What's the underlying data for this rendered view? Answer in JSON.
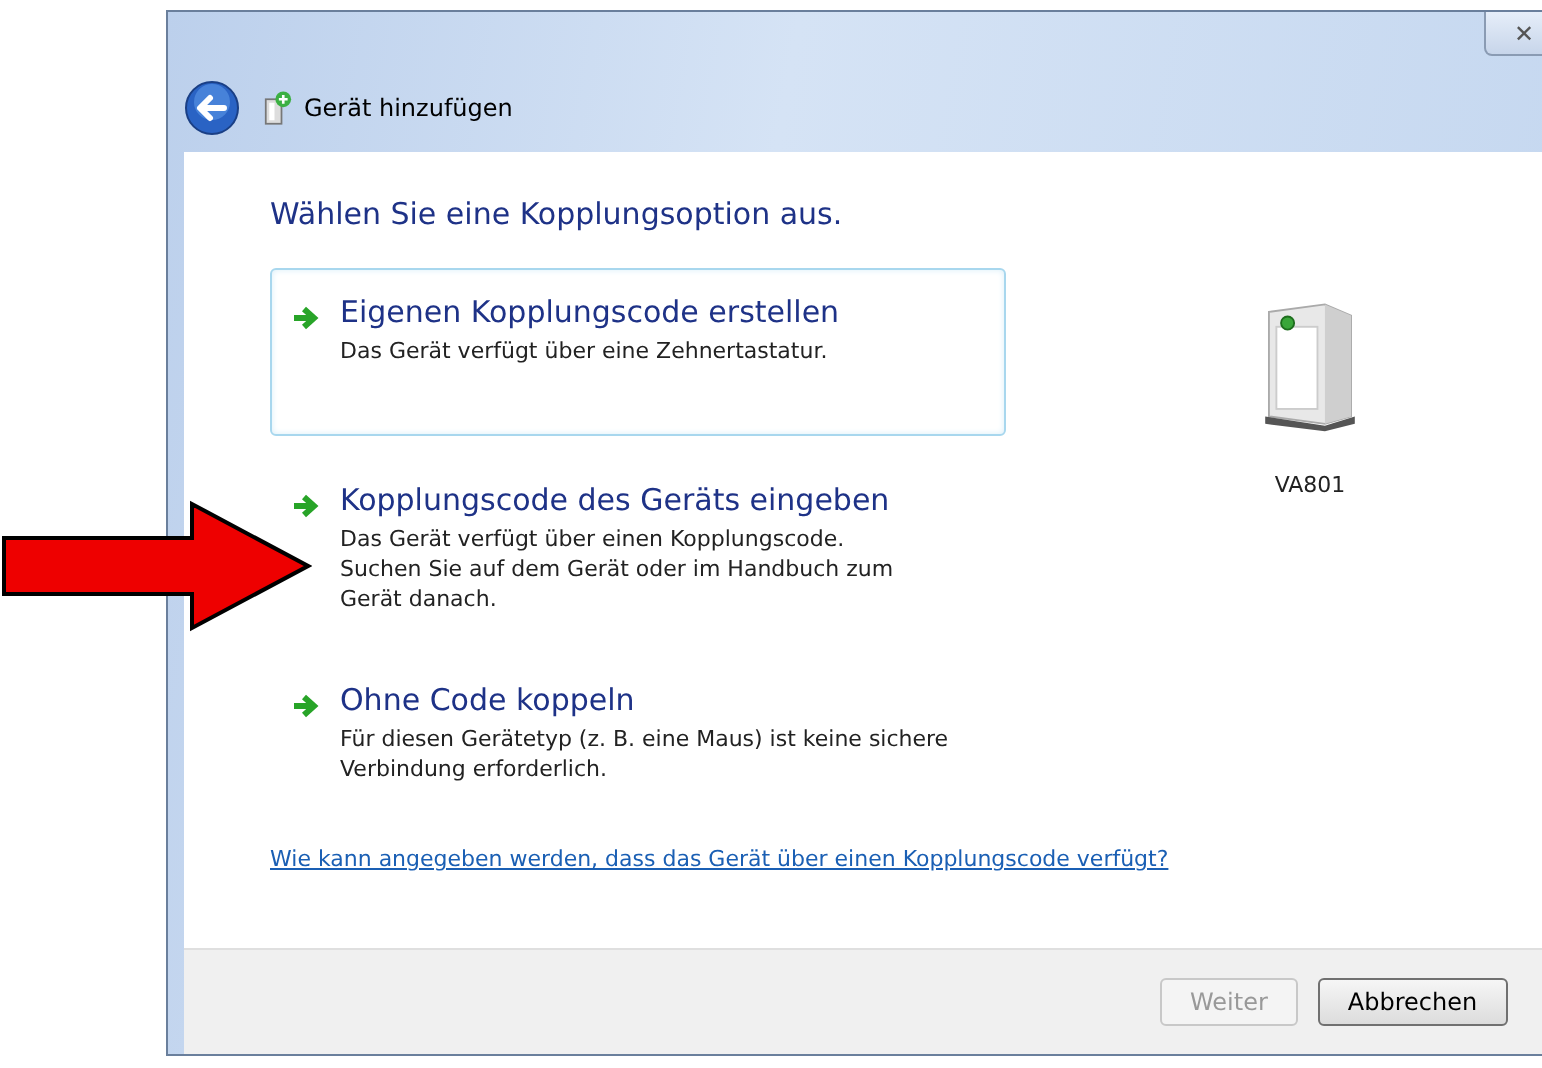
{
  "window": {
    "title": "Gerät hinzufügen",
    "close_label": "✕"
  },
  "heading": "Wählen Sie eine Kopplungsoption aus.",
  "options": [
    {
      "title": "Eigenen Kopplungscode erstellen",
      "description": "Das Gerät verfügt über eine Zehnertastatur.",
      "selected": true
    },
    {
      "title": "Kopplungscode des Geräts eingeben",
      "description": "Das Gerät verfügt über einen Kopplungscode.\nSuchen Sie auf dem Gerät oder im Handbuch zum\nGerät danach.",
      "selected": false
    },
    {
      "title": "Ohne Code koppeln",
      "description": "Für diesen Gerätetyp (z. B. eine Maus) ist keine sichere\nVerbindung erforderlich.",
      "selected": false
    }
  ],
  "device": {
    "label": "VA801"
  },
  "help_link": "Wie kann angegeben werden, dass das Gerät über einen Kopplungscode verfügt?",
  "buttons": [
    {
      "label": "Weiter",
      "disabled": true
    },
    {
      "label": "Abbrechen",
      "disabled": false
    }
  ]
}
